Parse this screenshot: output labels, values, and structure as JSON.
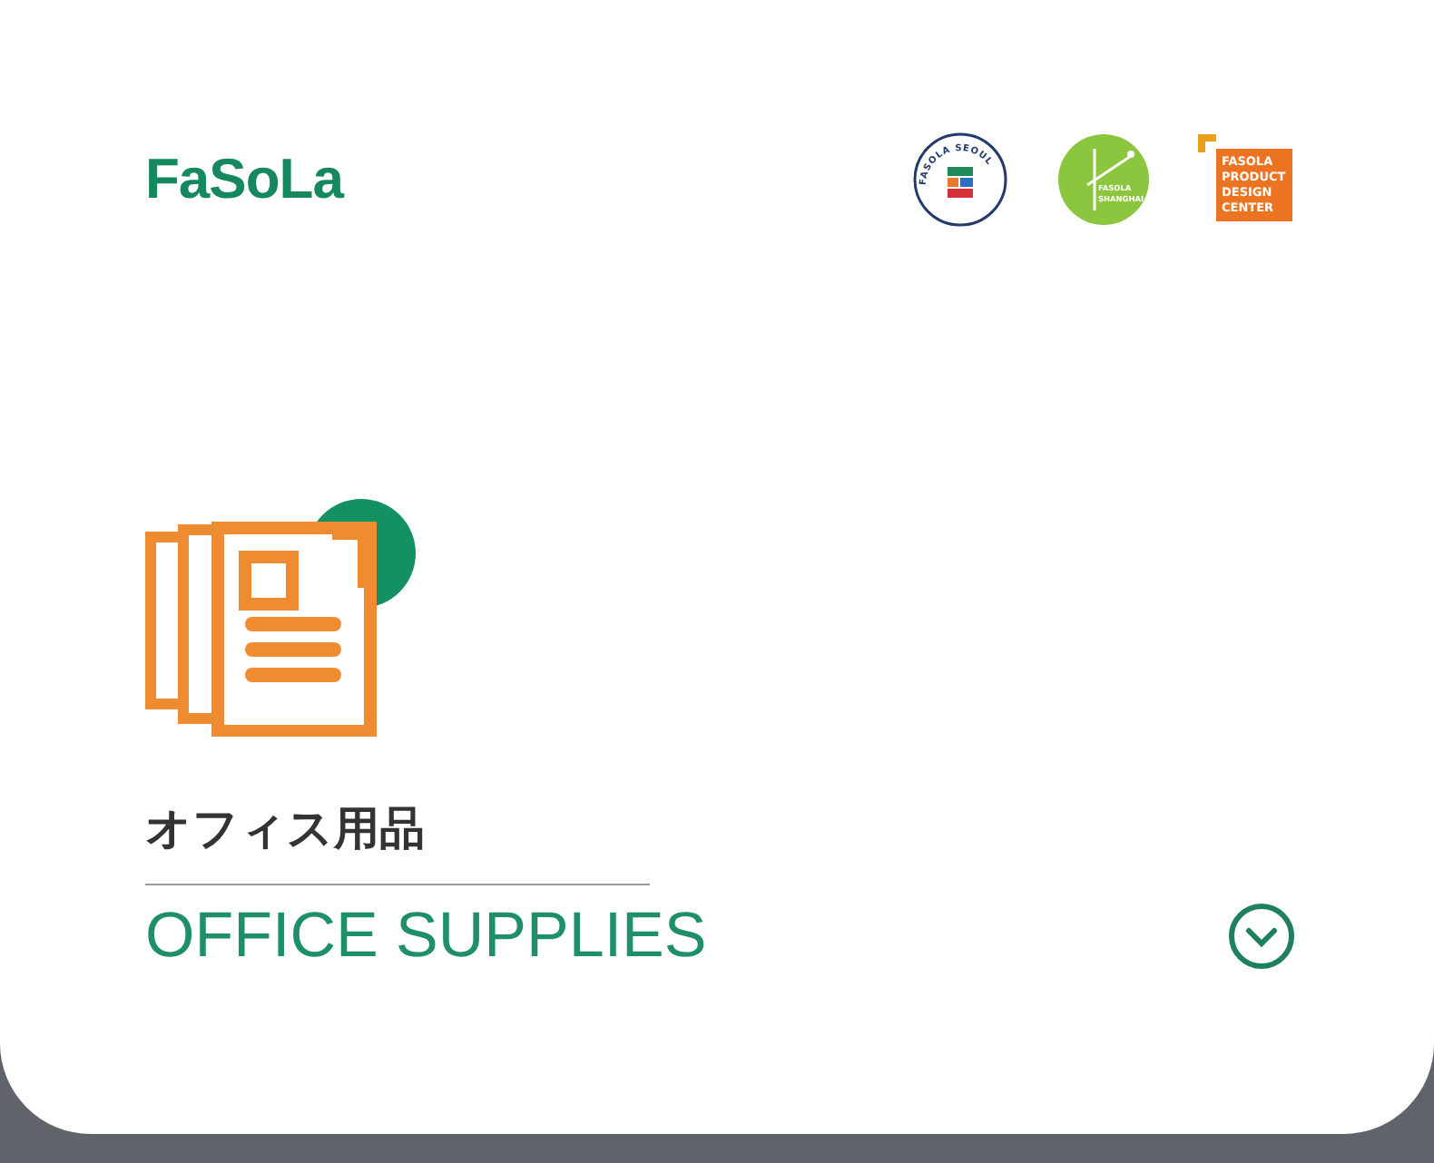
{
  "brand": {
    "logo": "FaSoLa"
  },
  "badges": [
    {
      "kind": "round",
      "lines": [
        "FASOLA SEOUL"
      ]
    },
    {
      "kind": "seal",
      "lines": [
        "FASOLA",
        "SHANGHAI"
      ]
    },
    {
      "kind": "square",
      "lines": [
        "FASOLA",
        "PRODUCT",
        "DESIGN",
        "CENTER"
      ]
    }
  ],
  "category": {
    "title": "オフィス用品",
    "subtitle": "OFFICE SUPPLIES",
    "expanded": false
  }
}
